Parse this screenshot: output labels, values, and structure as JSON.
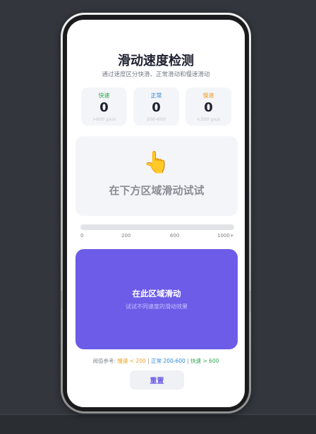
{
  "page": {
    "title": "滑动速度检测",
    "subtitle": "通过速度区分快滑、正常滑动和慢速滑动"
  },
  "stats": [
    {
      "label": "快速",
      "value": "0",
      "range": ">600 px/s",
      "color": "#2fa84f"
    },
    {
      "label": "正常",
      "value": "0",
      "range": "200-600",
      "color": "#2b87d8"
    },
    {
      "label": "慢速",
      "value": "0",
      "range": "<200 px/s",
      "color": "#f0a020"
    }
  ],
  "demo": {
    "icon": "pointing-hand-icon",
    "glyph": "👆",
    "text": "在下方区域滑动试试"
  },
  "speed_meter": {
    "level": 0,
    "ticks": [
      "0",
      "200",
      "600",
      "1000+"
    ]
  },
  "swipe_area": {
    "title": "在此区域滑动",
    "hint": "试试不同速度的滑动效果"
  },
  "threshold": {
    "prefix": "阈值参考: ",
    "slow": "慢速 < 200",
    "sep": " | ",
    "normal": "正常 200-600",
    "fast": "快速 > 600"
  },
  "reset_label": "重置",
  "colors": {
    "accent": "#6c5ce7",
    "fast": "#2fa84f",
    "normal": "#2b87d8",
    "slow": "#f0a020"
  }
}
